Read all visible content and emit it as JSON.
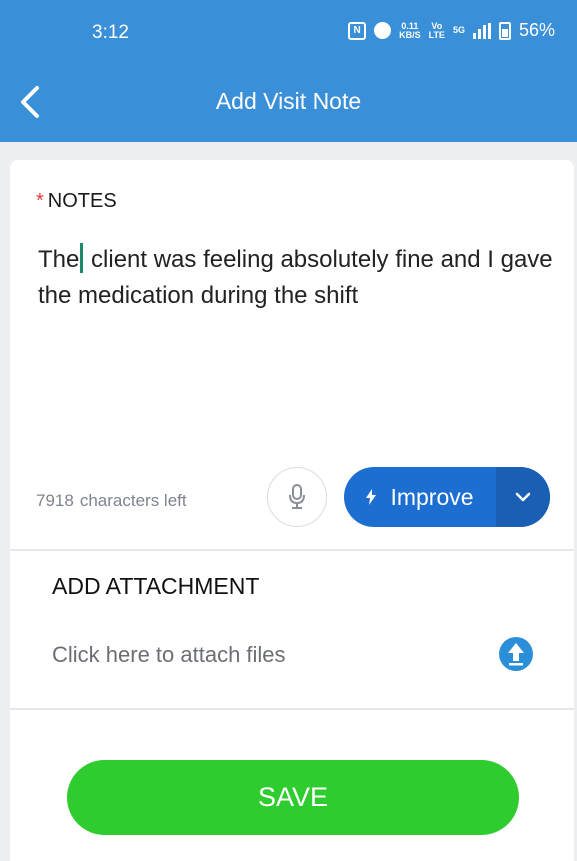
{
  "status_bar": {
    "time": "3:12",
    "net_speed_value": "0.11",
    "net_speed_unit": "KB/S",
    "volte_top": "Vo",
    "volte_bottom": "LTE",
    "network": "5G",
    "battery": "56%"
  },
  "header": {
    "title": "Add Visit Note",
    "back_icon": "chevron-left-icon"
  },
  "notes": {
    "label": "NOTES",
    "required_marker": "*",
    "text_before_caret": "The",
    "text_after_caret": " client was feeling absolutely fine and I gave the medication during the shift",
    "characters_left_count": "7918",
    "characters_left_suffix": "characters left"
  },
  "actions": {
    "mic_icon": "microphone-icon",
    "improve_label": "Improve",
    "improve_icon": "lightning-icon",
    "dropdown_icon": "chevron-down-icon"
  },
  "attachment": {
    "title": "ADD ATTACHMENT",
    "hint": "Click here to attach files",
    "upload_icon": "upload-icon"
  },
  "save_label": "SAVE",
  "colors": {
    "header_bg": "#3a8fd9",
    "improve_bg": "#1c6fd1",
    "save_bg": "#2ecc2e",
    "required": "#e53935"
  }
}
